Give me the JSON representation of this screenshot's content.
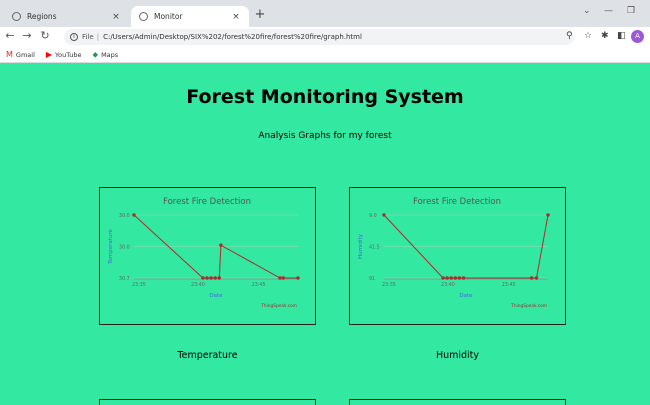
{
  "browser": {
    "tabs": [
      {
        "title": "Regions",
        "active": false
      },
      {
        "title": "Monitor",
        "active": true
      }
    ],
    "new_tab": "+",
    "close_glyph": "×",
    "address": {
      "scheme": "File",
      "url": "C:/Users/Admin/Desktop/SIX%202/forest%20fire/forest%20fire/graph.html"
    },
    "bookmarks": [
      {
        "label": "Gmail",
        "icon": "gmail-icon"
      },
      {
        "label": "YouTube",
        "icon": "youtube-icon"
      },
      {
        "label": "Maps",
        "icon": "maps-icon"
      }
    ],
    "profile_initial": "A"
  },
  "page": {
    "title": "Forest Monitoring System",
    "subtitle": "Analysis Graphs for my forest",
    "captions": [
      "Temperature",
      "Humidity"
    ]
  },
  "colors": {
    "background": "#33e8a0",
    "series_line": "#b3282d",
    "axis_label": "#3d6fd9",
    "chart_title": "#555555"
  },
  "chart_data": [
    {
      "type": "line",
      "title": "Forest Fire Detection",
      "xlabel": "Date",
      "ylabel": "Temperature",
      "credit": "ThingSpeak.com",
      "x_ticks": [
        "23:35",
        "23:40",
        "23:45"
      ],
      "y_ticks": [
        "30.0",
        "30.0",
        "30.7"
      ],
      "grid": true,
      "points": [
        {
          "x": 0.0,
          "y": 1.0
        },
        {
          "x": 0.42,
          "y": 0.0
        },
        {
          "x": 0.445,
          "y": 0.0
        },
        {
          "x": 0.47,
          "y": 0.0
        },
        {
          "x": 0.495,
          "y": 0.0
        },
        {
          "x": 0.52,
          "y": 0.0
        },
        {
          "x": 0.53,
          "y": 0.52
        },
        {
          "x": 0.89,
          "y": 0.0
        },
        {
          "x": 0.91,
          "y": 0.0
        },
        {
          "x": 1.0,
          "y": 0.0
        }
      ]
    },
    {
      "type": "line",
      "title": "Forest Fire Detection",
      "xlabel": "Date",
      "ylabel": "Humidity",
      "credit": "ThingSpeak.com",
      "x_ticks": [
        "23:35",
        "23:40",
        "23:45"
      ],
      "y_ticks": [
        "9.0",
        "41.5",
        "91"
      ],
      "grid": true,
      "points": [
        {
          "x": 0.0,
          "y": 1.0
        },
        {
          "x": 0.36,
          "y": 0.0
        },
        {
          "x": 0.385,
          "y": 0.0
        },
        {
          "x": 0.41,
          "y": 0.0
        },
        {
          "x": 0.435,
          "y": 0.0
        },
        {
          "x": 0.46,
          "y": 0.0
        },
        {
          "x": 0.485,
          "y": 0.0
        },
        {
          "x": 0.9,
          "y": 0.0
        },
        {
          "x": 0.93,
          "y": 0.0
        },
        {
          "x": 1.0,
          "y": 1.0
        }
      ]
    }
  ]
}
